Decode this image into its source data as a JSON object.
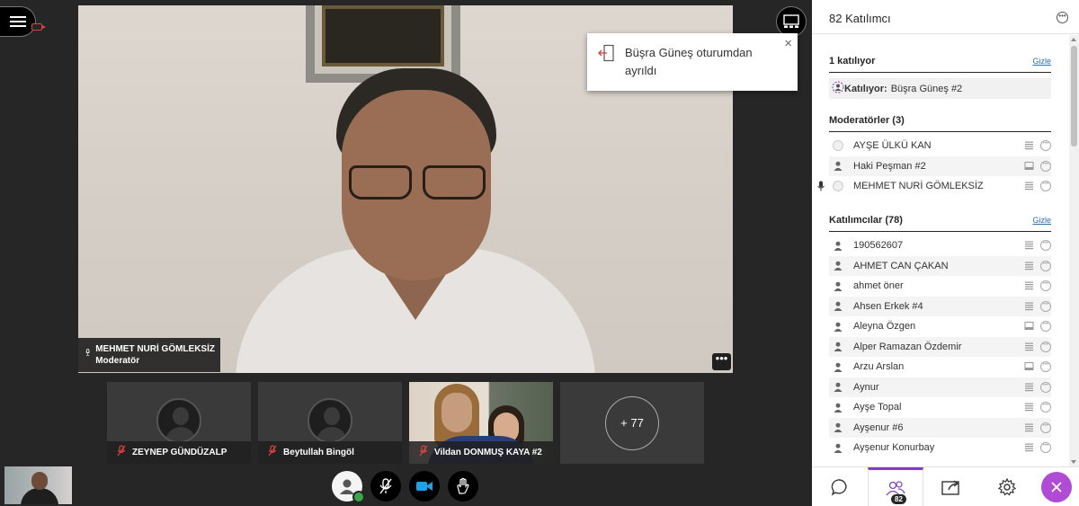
{
  "stage": {
    "toast": {
      "message": "Büşra Güneş oturumdan ayrıldı",
      "close_label": "×"
    },
    "active_speaker": {
      "name": "MEHMET NURİ GÖMLEKSİZ",
      "role": "Moderatör"
    },
    "more_label": "•••",
    "tiles": [
      {
        "name": "ZEYNEP GÜNDÜZALP"
      },
      {
        "name": "Beytullah Bingöl"
      },
      {
        "name": "Vildan DONMUŞ KAYA #2"
      }
    ],
    "more_count": "+ 77"
  },
  "panel": {
    "title": "82 Katılımcı",
    "joining": {
      "heading": "1 katılıyor",
      "toggle": "Gizle",
      "label": "Katılıyor:",
      "name": "Büşra Güneş #2"
    },
    "moderators": {
      "heading": "Moderatörler (3)",
      "items": [
        "AYŞE ÜLKÜ KAN",
        "Haki Peşman #2",
        "MEHMET NURİ GÖMLEKSİZ"
      ]
    },
    "participants": {
      "heading": "Katılımcılar (78)",
      "toggle": "Gizle",
      "items": [
        "190562607",
        "AHMET CAN ÇAKAN",
        "ahmet öner",
        "Ahsen Erkek #4",
        "Aleyna Özgen",
        "Alper Ramazan Özdemir",
        "Arzu Arslan",
        "Aynur",
        "Ayşe Topal",
        "Ayşenur #6",
        "Ayşenur Konurbay"
      ]
    },
    "badge_count": "82"
  },
  "colors": {
    "accent": "#7f3fbf",
    "close_button": "#b04bd6",
    "link": "#2a6fb0",
    "status_ok": "#3ba54a",
    "record": "#e04040"
  }
}
